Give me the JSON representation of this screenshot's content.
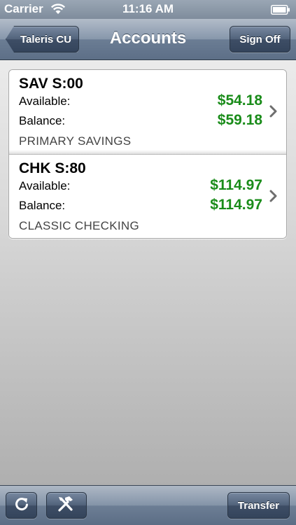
{
  "status_bar": {
    "carrier": "Carrier",
    "time": "11:16 AM"
  },
  "nav": {
    "back_label": "Taleris CU",
    "title": "Accounts",
    "sign_off_label": "Sign Off"
  },
  "accounts": [
    {
      "name": "SAV S:00",
      "available_label": "Available:",
      "available_value": "$54.18",
      "balance_label": "Balance:",
      "balance_value": "$59.18",
      "description": "PRIMARY SAVINGS"
    },
    {
      "name": "CHK S:80",
      "available_label": "Available:",
      "available_value": "$114.97",
      "balance_label": "Balance:",
      "balance_value": "$114.97",
      "description": "CLASSIC CHECKING"
    }
  ],
  "toolbar": {
    "refresh_icon": "refresh-icon",
    "tools_icon": "tools-icon",
    "transfer_label": "Transfer"
  },
  "colors": {
    "amount_green": "#1a8c1a",
    "nav_blue": "#6b7d94"
  }
}
